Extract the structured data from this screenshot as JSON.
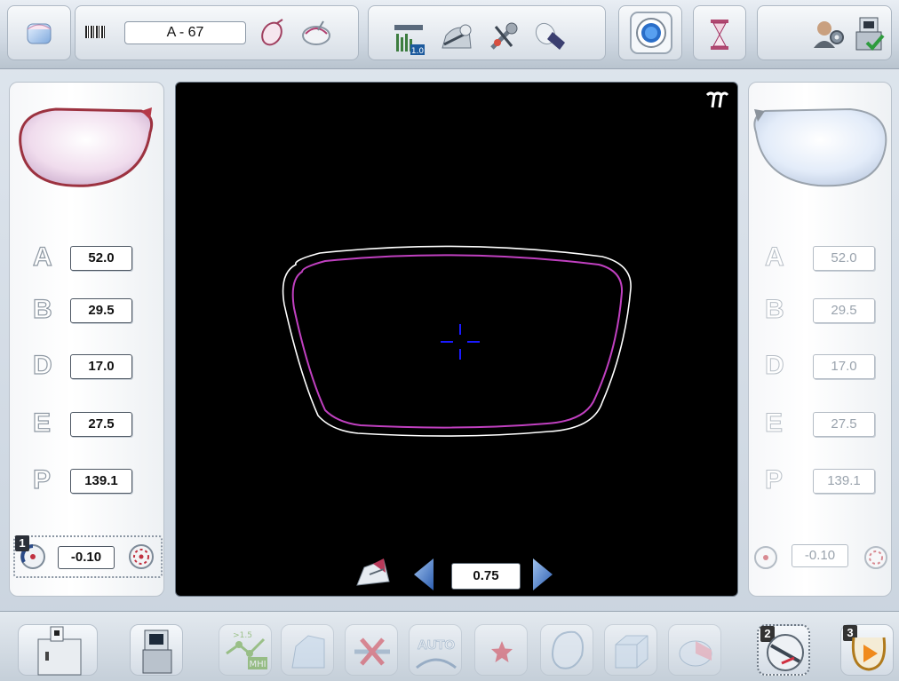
{
  "toolbar": {
    "job_number": "A - 67"
  },
  "left_lens": {
    "dimensions": [
      {
        "letter": "A",
        "value": "52.0"
      },
      {
        "letter": "B",
        "value": "29.5"
      },
      {
        "letter": "D",
        "value": "17.0"
      },
      {
        "letter": "E",
        "value": "27.5"
      },
      {
        "letter": "P",
        "value": "139.1"
      }
    ],
    "tolerance": {
      "step": "1",
      "value": "-0.10"
    }
  },
  "right_lens": {
    "dimensions": [
      {
        "letter": "A",
        "value": "52.0"
      },
      {
        "letter": "B",
        "value": "29.5"
      },
      {
        "letter": "D",
        "value": "17.0"
      },
      {
        "letter": "E",
        "value": "27.5"
      },
      {
        "letter": "P",
        "value": "139.1"
      }
    ],
    "tolerance": {
      "value": "-0.10"
    }
  },
  "display": {
    "zoom_value": "0.75",
    "colors": {
      "outer_contour": "#ffffff",
      "inner_contour": "#c040c0",
      "crosshair": "#1a1aff"
    }
  },
  "bottom_toolbar": {
    "mhi_top": ">1.5",
    "mhi_bottom": "MHI",
    "auto_label": "AUTO",
    "step2": "2",
    "step3": "3"
  }
}
